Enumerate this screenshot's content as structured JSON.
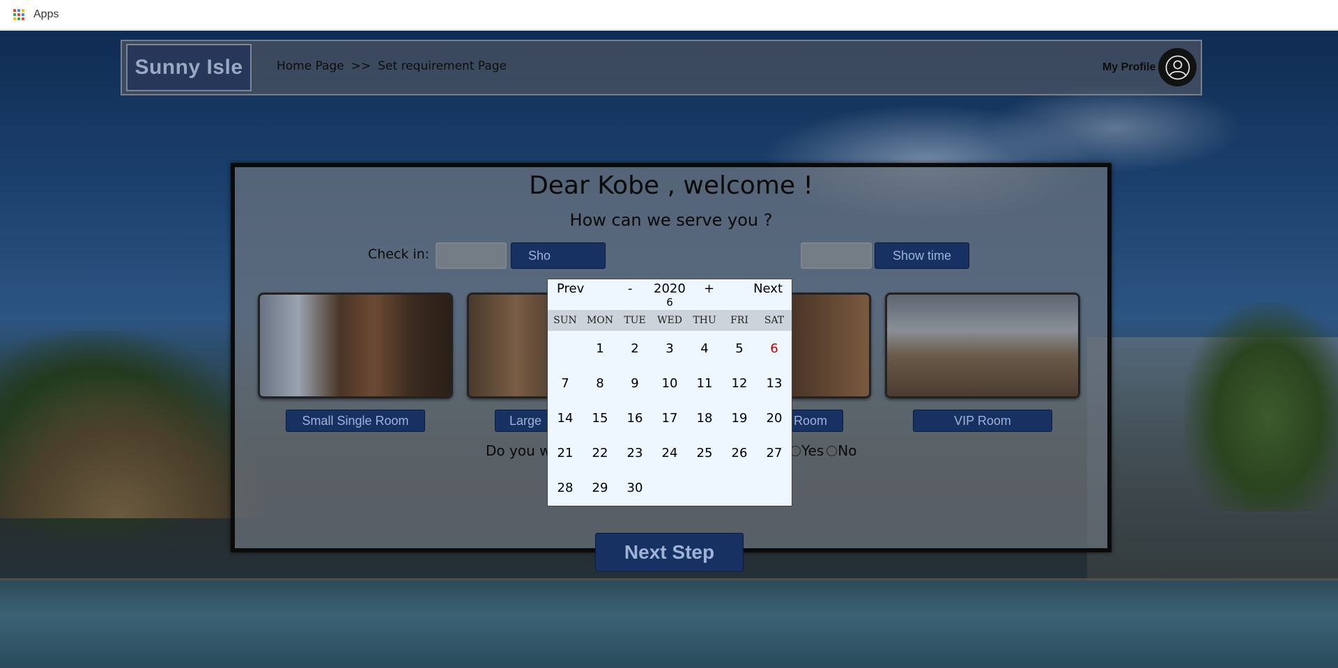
{
  "bookmarks": {
    "apps_label": "Apps"
  },
  "header": {
    "logo": "Sunny Isle",
    "breadcrumb": {
      "home": "Home Page",
      "separator": ">>",
      "current": "Set requirement Page"
    },
    "profile_label": "My Profile"
  },
  "panel": {
    "welcome": "Dear Kobe , welcome !",
    "subtitle": "How can we serve you ?",
    "checkin_label": "Check in:",
    "show_time_label": "Show time",
    "show_time_partial": "Sho",
    "rooms": [
      {
        "label": "Small Single Room"
      },
      {
        "label": "Large"
      },
      {
        "label": "Room"
      },
      {
        "label": "VIP Room"
      }
    ],
    "question_partial": "Do you w",
    "radio_yes": "Yes",
    "radio_no": "No",
    "next_step": "Next Step"
  },
  "calendar": {
    "prev": "Prev",
    "minus": "-",
    "year": "2020",
    "plus": "+",
    "next": "Next",
    "month": "6",
    "weekdays": [
      "SUN",
      "MON",
      "TUE",
      "WED",
      "THU",
      "FRI",
      "SAT"
    ],
    "days": [
      "",
      "1",
      "2",
      "3",
      "4",
      "5",
      "6",
      "7",
      "8",
      "9",
      "10",
      "11",
      "12",
      "13",
      "14",
      "15",
      "16",
      "17",
      "18",
      "19",
      "20",
      "21",
      "22",
      "23",
      "24",
      "25",
      "26",
      "27",
      "28",
      "29",
      "30"
    ],
    "today": "6",
    "today_color": "#c00000"
  },
  "colors": {
    "button_bg": "#173163",
    "button_text": "#9fb3d6",
    "logo_bg": "#26375a"
  }
}
